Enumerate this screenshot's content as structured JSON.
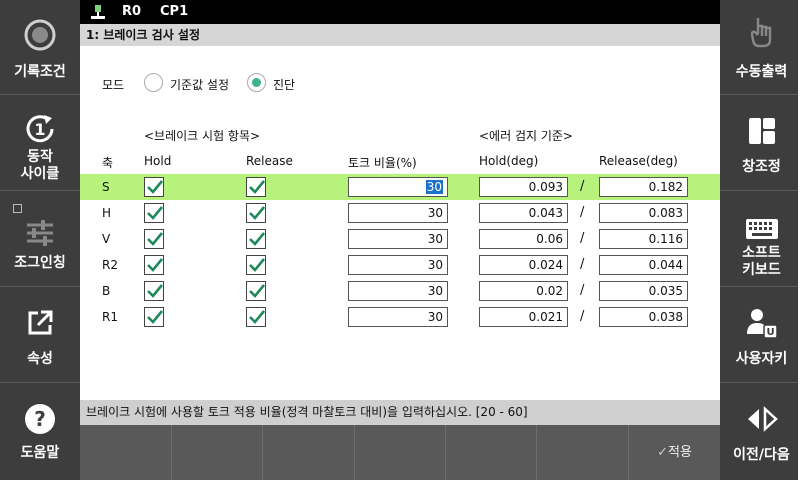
{
  "left_panel": {
    "record_condition": "기록조건",
    "operation_cycle": [
      "동작",
      "사이클"
    ],
    "jogging": "조그인칭",
    "properties": "속성",
    "help": "도움말"
  },
  "right_panel": {
    "manual_output": "수동출력",
    "window_arrange": "창조정",
    "soft_keyboard_line1": "소프트",
    "soft_keyboard_line2": "키보드",
    "user_key": "사용자키",
    "prev_next": "이전/다음"
  },
  "topbar": {
    "robot": "R0",
    "program": "CP1"
  },
  "title": "1: 브레이크 검사 설정",
  "mode": {
    "label": "모드",
    "option1": "기준값 설정",
    "option2": "진단",
    "selected": "진단"
  },
  "headers": {
    "brake_test_items": "<브레이크 시험 항목>",
    "error_detection": "<에러 검지 기준>",
    "axis": "축",
    "hold": "Hold",
    "release": "Release",
    "torque_ratio": "토크 비율(%)",
    "hold_deg": "Hold(deg)",
    "release_deg": "Release(deg)"
  },
  "rows": [
    {
      "axis": "S",
      "hold": true,
      "release": true,
      "torque": "30",
      "hold_deg": "0.093",
      "release_deg": "0.182",
      "selected": true
    },
    {
      "axis": "H",
      "hold": true,
      "release": true,
      "torque": "30",
      "hold_deg": "0.043",
      "release_deg": "0.083"
    },
    {
      "axis": "V",
      "hold": true,
      "release": true,
      "torque": "30",
      "hold_deg": "0.06",
      "release_deg": "0.116"
    },
    {
      "axis": "R2",
      "hold": true,
      "release": true,
      "torque": "30",
      "hold_deg": "0.024",
      "release_deg": "0.044"
    },
    {
      "axis": "B",
      "hold": true,
      "release": true,
      "torque": "30",
      "hold_deg": "0.02",
      "release_deg": "0.035"
    },
    {
      "axis": "R1",
      "hold": true,
      "release": true,
      "torque": "30",
      "hold_deg": "0.021",
      "release_deg": "0.038"
    }
  ],
  "separator": "/",
  "status_message": "브레이크 시험에 사용할 토크 적용 비율(정격 마찰토크 대비)을 입력하십시오. [20 - 60]",
  "apply_label": "적용",
  "colors": {
    "highlight_row": "#b7f27c",
    "radio_selected": "#3cb48c",
    "check": "#1e8a5a",
    "selection": "#1a73c8"
  }
}
